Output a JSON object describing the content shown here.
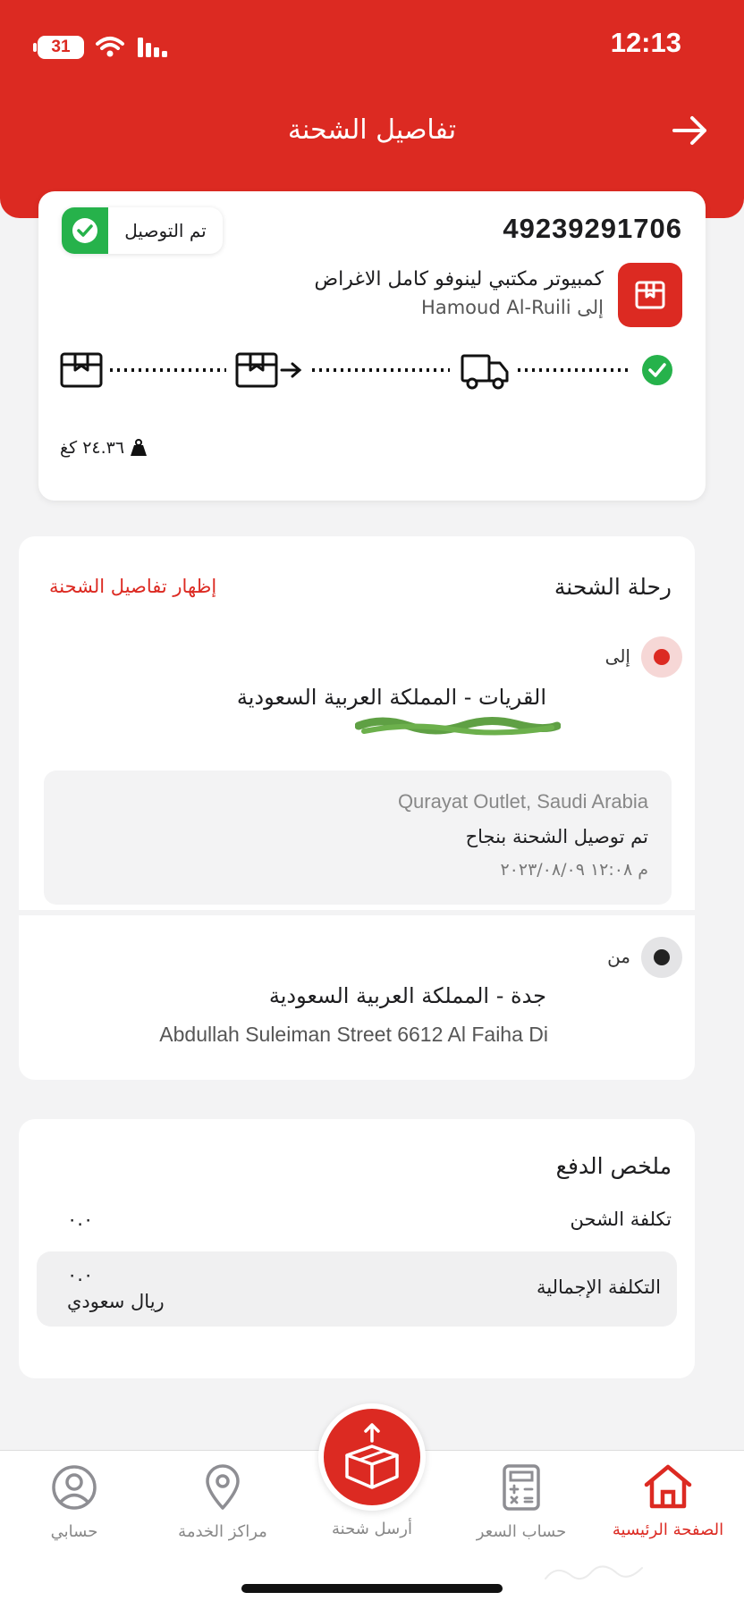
{
  "status_bar": {
    "time": "12:13",
    "battery": "31"
  },
  "header": {
    "title": "تفاصيل الشحنة"
  },
  "shipment": {
    "tracking_number": "49239291706",
    "status_badge": "تم التوصيل",
    "item_name": "كمبيوتر مكتبي لينوفو كامل الاغراض",
    "recipient_line": "إلى Hamoud Al-Ruili",
    "weight": "٢٤.٣٦ كغ"
  },
  "journey": {
    "title": "رحلة الشحنة",
    "show_details_link": "إظهار تفاصيل الشحنة",
    "to": {
      "label": "إلى",
      "city": "القريات - المملكة العربية السعودية"
    },
    "event": {
      "outlet": "Qurayat Outlet, Saudi Arabia",
      "status": "تم توصيل الشحنة بنجاح",
      "time": "م ١٢:٠٨ ٢٠٢٣/٠٨/٠٩"
    },
    "from": {
      "label": "من",
      "city": "جدة - المملكة العربية السعودية",
      "address": "Abdullah Suleiman Street  6612  Al Faiha Di"
    }
  },
  "payment": {
    "title": "ملخص الدفع",
    "shipping_cost_label": "تكلفة الشحن",
    "shipping_cost_value": "٠.٠",
    "total_label": "التكلفة الإجمالية",
    "total_value": "٠.٠",
    "currency": "ريال سعودي"
  },
  "tabbar": {
    "home": "الصفحة الرئيسية",
    "price_calc": "حساب السعر",
    "send_shipment": "أرسل شحنة",
    "service_centers": "مراكز الخدمة",
    "account": "حسابي"
  },
  "colors": {
    "brand_red": "#dc2a22",
    "success_green": "#26b24b"
  },
  "icons": [
    "wifi-icon",
    "signal-icon",
    "back-arrow-icon",
    "check-icon",
    "package-icon",
    "truck-icon",
    "weight-icon",
    "home-icon",
    "calculator-icon",
    "send-box-icon",
    "location-pin-icon",
    "user-icon"
  ]
}
